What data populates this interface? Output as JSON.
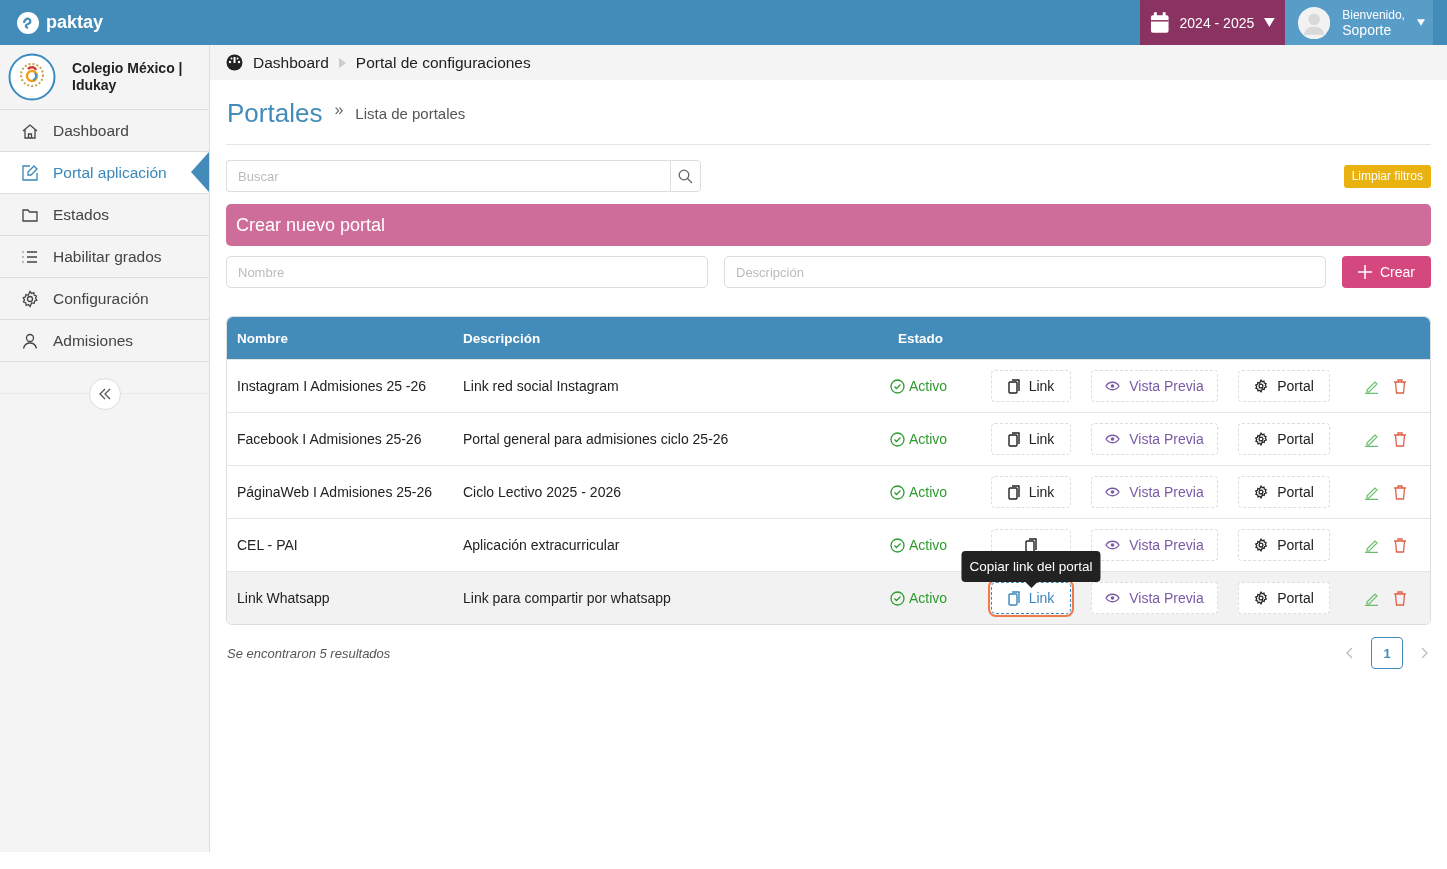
{
  "topbar": {
    "brand": "paktay",
    "school_year": "2024 - 2025",
    "greeting": "Bienvenido,",
    "user": "Soporte"
  },
  "sidebar": {
    "school": "Colegio México | Idukay",
    "items": [
      {
        "label": "Dashboard",
        "selected": false
      },
      {
        "label": "Portal aplicación",
        "selected": true
      },
      {
        "label": "Estados",
        "selected": false
      },
      {
        "label": "Habilitar grados",
        "selected": false
      },
      {
        "label": "Configuración",
        "selected": false
      },
      {
        "label": "Admisiones",
        "selected": false
      }
    ]
  },
  "breadcrumb": [
    "Dashboard",
    "Portal de configuraciones"
  ],
  "page": {
    "title": "Portales",
    "separator": "»",
    "subtitle": "Lista de portales"
  },
  "search": {
    "placeholder": "Buscar"
  },
  "clear_filters": "Limpiar filtros",
  "create_panel": {
    "title": "Crear nuevo portal",
    "name_placeholder": "Nombre",
    "description_placeholder": "Descripción",
    "button": "Crear"
  },
  "table": {
    "columns": [
      "Nombre",
      "Descripción",
      "Estado"
    ],
    "rows": [
      {
        "name": "Instagram I Admisiones 25 -26",
        "description": "Link red social Instagram",
        "status": "Activo",
        "link_button": "Link",
        "preview_button": "Vista Previa",
        "portal_button": "Portal",
        "highlighted": false,
        "focused": false
      },
      {
        "name": "Facebook I Admisiones 25-26",
        "description": "Portal general para admisiones ciclo 25-26",
        "status": "Activo",
        "link_button": "Link",
        "preview_button": "Vista Previa",
        "portal_button": "Portal",
        "highlighted": false,
        "focused": false
      },
      {
        "name": "PáginaWeb I Admisiones 25-26",
        "description": "Ciclo Lectivo 2025 - 2026",
        "status": "Activo",
        "link_button": "Link",
        "preview_button": "Vista Previa",
        "portal_button": "Portal",
        "highlighted": false,
        "focused": false
      },
      {
        "name": "CEL - PAI",
        "description": "Aplicación extracurricular",
        "status": "Activo",
        "preview_button": "Vista Previa",
        "portal_button": "Portal",
        "highlighted": false,
        "focused": false
      },
      {
        "name": "Link Whatsapp",
        "description": "Link para compartir por whatsapp",
        "status": "Activo",
        "link_button": "Link",
        "preview_button": "Vista Previa",
        "portal_button": "Portal",
        "highlighted": true,
        "focused": true,
        "tooltip": "Copiar link del portal"
      }
    ]
  },
  "results": "Se encontraron 5 resultados",
  "pagination": [
    {
      "label": "1",
      "selected": true
    }
  ]
}
